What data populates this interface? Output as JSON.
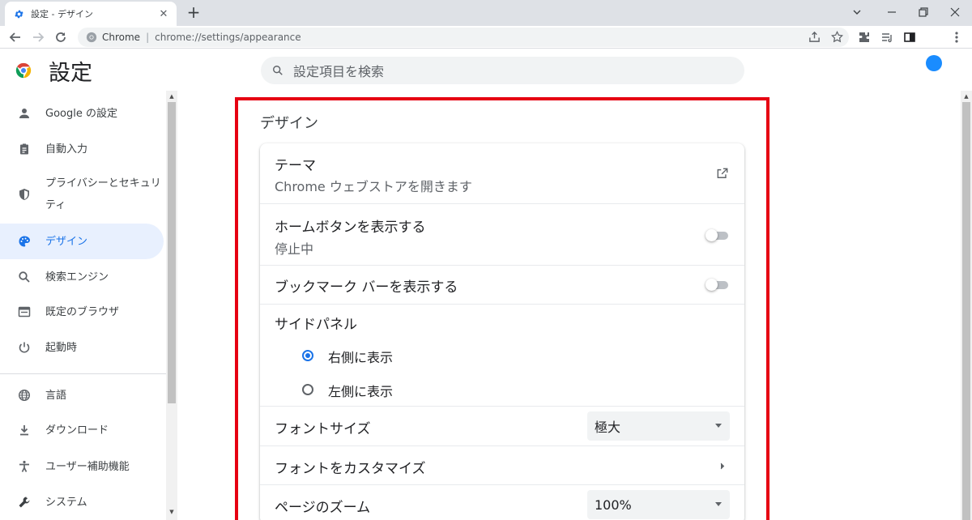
{
  "browser": {
    "tab_title": "設定 - デザイン",
    "tab_close": "✕",
    "new_tab": "+",
    "omnibox_site": "Chrome",
    "omnibox_url": "chrome://settings/appearance"
  },
  "settings": {
    "title": "設定",
    "search_placeholder": "設定項目を検索"
  },
  "sidebar": {
    "items": [
      {
        "label": "Google の設定",
        "icon": "person-icon"
      },
      {
        "label": "自動入力",
        "icon": "clipboard-icon"
      },
      {
        "label": "プライバシーとセキュリティ",
        "icon": "shield-icon"
      },
      {
        "label": "デザイン",
        "icon": "palette-icon",
        "active": true
      },
      {
        "label": "検索エンジン",
        "icon": "search-icon"
      },
      {
        "label": "既定のブラウザ",
        "icon": "browser-icon"
      },
      {
        "label": "起動時",
        "icon": "power-icon"
      },
      {
        "label": "言語",
        "icon": "globe-icon"
      },
      {
        "label": "ダウンロード",
        "icon": "download-icon"
      },
      {
        "label": "ユーザー補助機能",
        "icon": "accessibility-icon"
      },
      {
        "label": "システム",
        "icon": "wrench-icon"
      }
    ]
  },
  "appearance": {
    "section_title": "デザイン",
    "theme": {
      "label": "テーマ",
      "sublabel": "Chrome ウェブストアを開きます"
    },
    "home_button": {
      "label": "ホームボタンを表示する",
      "sublabel": "停止中",
      "enabled": false
    },
    "bookmarks_bar": {
      "label": "ブックマーク バーを表示する",
      "enabled": false
    },
    "side_panel": {
      "label": "サイドパネル",
      "options": [
        {
          "label": "右側に表示",
          "selected": true
        },
        {
          "label": "左側に表示",
          "selected": false
        }
      ]
    },
    "font_size": {
      "label": "フォントサイズ",
      "value": "極大"
    },
    "customize_fonts": {
      "label": "フォントをカスタマイズ"
    },
    "page_zoom": {
      "label": "ページのズーム",
      "value": "100%"
    }
  },
  "colors": {
    "accent": "#1a73e8",
    "highlight_border": "#e60012",
    "active_nav_bg": "#e8f0fe"
  }
}
